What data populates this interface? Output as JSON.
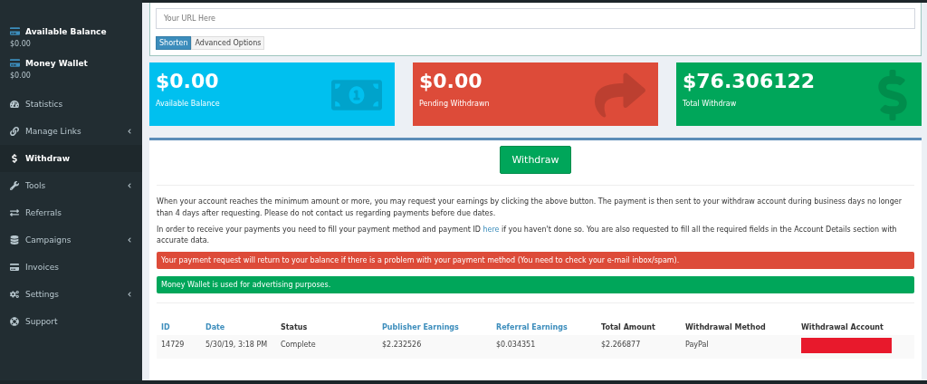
{
  "sidebar": {
    "balances": [
      {
        "label": "Available Balance",
        "amount": "$0.00"
      },
      {
        "label": "Money Wallet",
        "amount": "$0.00"
      }
    ],
    "items": [
      {
        "label": "Statistics",
        "selected": false,
        "expandable": false
      },
      {
        "label": "Manage Links",
        "selected": false,
        "expandable": true
      },
      {
        "label": "Withdraw",
        "selected": true,
        "expandable": false
      },
      {
        "label": "Tools",
        "selected": false,
        "expandable": true
      },
      {
        "label": "Referrals",
        "selected": false,
        "expandable": false
      },
      {
        "label": "Campaigns",
        "selected": false,
        "expandable": true
      },
      {
        "label": "Invoices",
        "selected": false,
        "expandable": false
      },
      {
        "label": "Settings",
        "selected": false,
        "expandable": true
      },
      {
        "label": "Support",
        "selected": false,
        "expandable": false
      }
    ]
  },
  "shorten_form": {
    "placeholder": "Your URL Here",
    "buttons": [
      {
        "label": "Shorten",
        "kind": "primary"
      },
      {
        "label": "Advanced Options",
        "kind": "default"
      }
    ]
  },
  "stats": [
    {
      "value": "$0.00",
      "label": "Available Balance",
      "color": "#00c0ef",
      "kind": "money"
    },
    {
      "value": "$0.00",
      "label": "Pending Withdrawn",
      "color": "#dd4b39",
      "kind": "share"
    },
    {
      "value": "$76.306122",
      "label": "Total Withdraw",
      "color": "#00a65a",
      "kind": "dollar"
    }
  ],
  "withdraw_button": "Withdraw",
  "paragraphs": [
    "When your account reaches the minimum amount or more, you may request your earnings by clicking the above button. The payment is then sent to your withdraw account during business days no longer than 4 days after requesting. Please do not contact us regarding payments before due dates."
  ],
  "payment_note": {
    "before": "In order to receive your payments you need to fill your payment method and payment ID ",
    "link": "here",
    "after": " if you haven't done so. You are also requested to fill all the required fields in the Account Details section with accurate data."
  },
  "alerts": [
    {
      "text": "Your payment request will return to your balance if there is a problem with your payment method (You need to check your e-mail inbox/spam).",
      "color": "#dd4b39"
    },
    {
      "text": "Money Wallet is used for advertising purposes.",
      "color": "#00a65a"
    }
  ],
  "table": {
    "columns": [
      {
        "label": "ID",
        "sortable": true
      },
      {
        "label": "Date",
        "sortable": true
      },
      {
        "label": "Status",
        "sortable": false
      },
      {
        "label": "Publisher Earnings",
        "sortable": true
      },
      {
        "label": "Referral Earnings",
        "sortable": true
      },
      {
        "label": "Total Amount",
        "sortable": false
      },
      {
        "label": "Withdrawal Method",
        "sortable": false
      },
      {
        "label": "Withdrawal Account",
        "sortable": false
      }
    ],
    "rows": [
      {
        "cells": [
          {
            "text": "14729"
          },
          {
            "text": "5/30/19, 3:18 PM"
          },
          {
            "text": "Complete"
          },
          {
            "text": "$2.232526"
          },
          {
            "text": "$0.034351"
          },
          {
            "text": "$2.266877"
          },
          {
            "text": "PayPal"
          },
          {
            "kind": "redacted"
          }
        ]
      }
    ]
  }
}
